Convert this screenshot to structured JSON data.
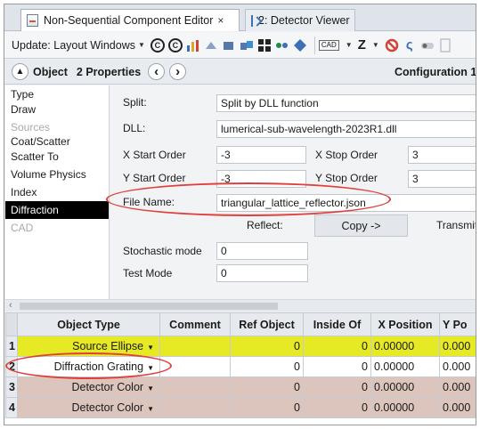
{
  "tabs": [
    {
      "label": "Non-Sequential Component Editor",
      "close": "×"
    },
    {
      "label": "2: Detector Viewer"
    }
  ],
  "toolbar": {
    "update_label": "Update: Layout Windows",
    "cad_label": "CAD",
    "z_label": "Z"
  },
  "propbar": {
    "object_label": "Object",
    "properties_label": "2 Properties",
    "prev": "‹",
    "next": "›",
    "config_label": "Configuration 1"
  },
  "nav": [
    "Type",
    "Draw",
    "Sources",
    "Coat/Scatter",
    "Scatter To",
    "Volume Physics",
    "Index",
    "Diffraction",
    "CAD"
  ],
  "editor": {
    "split_label": "Split:",
    "split_value": "Split by DLL function",
    "dll_label": "DLL:",
    "dll_value": "lumerical-sub-wavelength-2023R1.dll",
    "x_start_label": "X Start Order",
    "x_start_value": "-3",
    "x_stop_label": "X Stop Order",
    "x_stop_value": "3",
    "y_start_label": "Y Start Order",
    "y_start_value": "-3",
    "y_stop_label": "Y Stop Order",
    "y_stop_value": "3",
    "file_label": "File Name:",
    "file_value": "triangular_lattice_reflector.json",
    "reflect_label": "Reflect:",
    "copy_label": "Copy ->",
    "transmit_label": "Transmit",
    "stochastic_label": "Stochastic mode",
    "stochastic_value": "0",
    "test_label": "Test Mode",
    "test_value": "0"
  },
  "grid": {
    "headers": [
      "Object Type",
      "Comment",
      "Ref Object",
      "Inside Of",
      "X Position",
      "Y Po"
    ],
    "rows": [
      {
        "num": "1",
        "type": "Source Ellipse",
        "comment": "",
        "ref": "0",
        "inside": "0",
        "x": "0.00000",
        "y": "0.000"
      },
      {
        "num": "2",
        "type": "Diffraction Grating",
        "comment": "",
        "ref": "0",
        "inside": "0",
        "x": "0.00000",
        "y": "0.000"
      },
      {
        "num": "3",
        "type": "Detector Color",
        "comment": "",
        "ref": "0",
        "inside": "0",
        "x": "0.00000",
        "y": "0.000"
      },
      {
        "num": "4",
        "type": "Detector Color",
        "comment": "",
        "ref": "0",
        "inside": "0",
        "x": "0.00000",
        "y": "0.000"
      }
    ]
  },
  "colors": {
    "row_source": "#e6ea24",
    "row_detector": "#dcc5bc",
    "annotation": "#e0403a",
    "selected_nav": "#000000"
  }
}
